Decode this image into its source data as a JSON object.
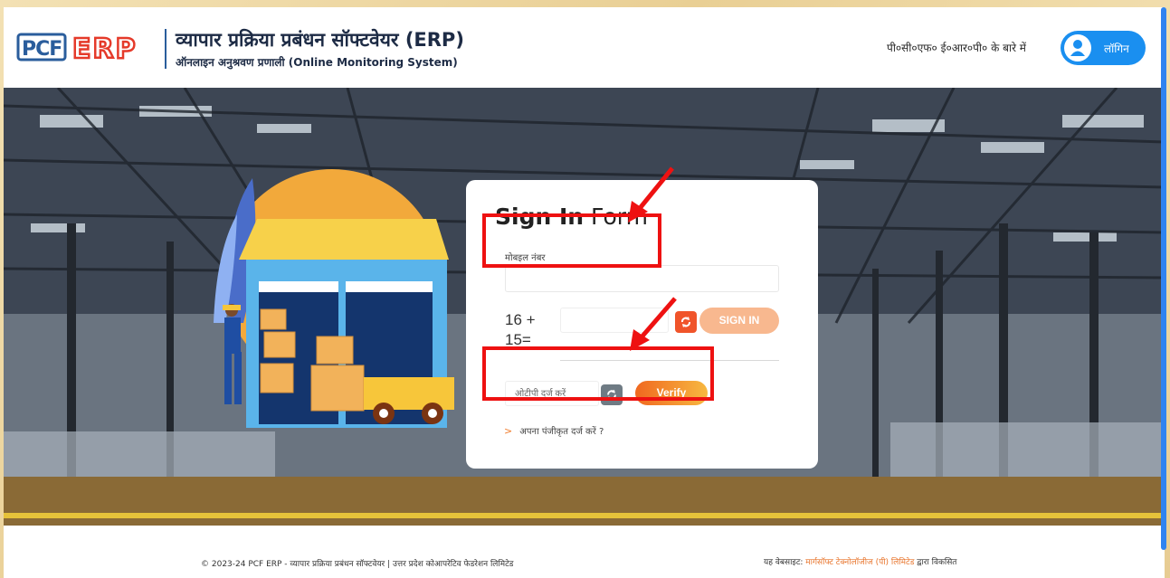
{
  "header": {
    "title": "व्यापार प्रक्रिया प्रबंधन सॉफ्टवेयर (ERP)",
    "subtitle": "ऑनलाइन अनुश्रवण प्रणाली (Online Monitoring System)",
    "about_link": "पी०सी०एफ० ई०आर०पी० के बारे में",
    "login_label": "लॉगिन",
    "logo_text": "PCF ERP"
  },
  "form": {
    "title_bold": "Sign In",
    "title_rest": " Form",
    "mobile_label": "मोबइल नंबर",
    "mobile_value": "",
    "captcha_question": "16 + 15=",
    "captcha_value": "",
    "signin_label": "SIGN IN",
    "otp_placeholder": "ओटीपी दर्ज करें",
    "verify_label": "Verify",
    "register_link": "अपना पंजीकृत दर्ज करें ?"
  },
  "footer": {
    "copyright": "© 2023-24 PCF ERP - व्यापार प्रक्रिया प्रबंधन सॉफ्टवेयर | उत्तर प्रदेश कोआपरेटिव फेडरेशन लिमिटेड",
    "developed_prefix": "यह वेबसाइट: ",
    "developed_company": "मार्गसॉफ्ट टेक्नोलॉजीज (पी) लिमिटेड",
    "developed_suffix": " द्वारा विकसित"
  },
  "colors": {
    "accent_blue": "#1a8ff0",
    "accent_orange": "#f06820",
    "annotation_red": "#ee1111",
    "logo_blue": "#2a5d9c",
    "logo_red": "#e53a2a"
  }
}
